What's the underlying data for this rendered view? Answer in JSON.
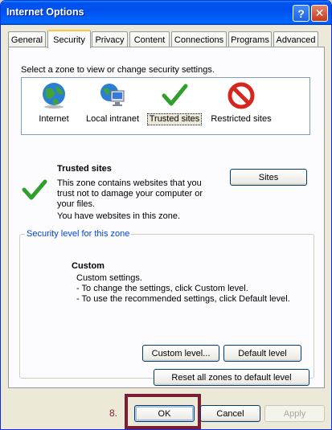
{
  "window": {
    "title": "Internet Options",
    "help_glyph": "?",
    "close_glyph": "✕"
  },
  "tabs": [
    {
      "label": "General"
    },
    {
      "label": "Security"
    },
    {
      "label": "Privacy"
    },
    {
      "label": "Content"
    },
    {
      "label": "Connections"
    },
    {
      "label": "Programs"
    },
    {
      "label": "Advanced"
    }
  ],
  "security": {
    "instruction": "Select a zone to view or change security settings.",
    "zones": [
      {
        "label": "Internet",
        "icon": "globe-icon"
      },
      {
        "label": "Local intranet",
        "icon": "intranet-icon"
      },
      {
        "label": "Trusted sites",
        "icon": "checkmark-icon",
        "selected": true
      },
      {
        "label": "Restricted sites",
        "icon": "restricted-icon"
      }
    ],
    "zone_title": "Trusted sites",
    "zone_description": "This zone contains websites that you trust not to damage your computer or your files.",
    "zone_status": "You have websites in this zone.",
    "sites_button": "Sites",
    "level_group_title": "Security level for this zone",
    "level_name": "Custom",
    "level_lines": [
      "Custom settings.",
      "- To change the settings, click Custom level.",
      "- To use the recommended settings, click Default level."
    ],
    "custom_level_button": "Custom level...",
    "default_level_button": "Default level",
    "reset_button": "Reset all zones to default level"
  },
  "footer": {
    "ok": "OK",
    "cancel": "Cancel",
    "apply": "Apply",
    "step_label": "8."
  },
  "colors": {
    "titlebar": "#0053ee",
    "highlight": "#7b1d34",
    "group_title": "#0046d5"
  }
}
